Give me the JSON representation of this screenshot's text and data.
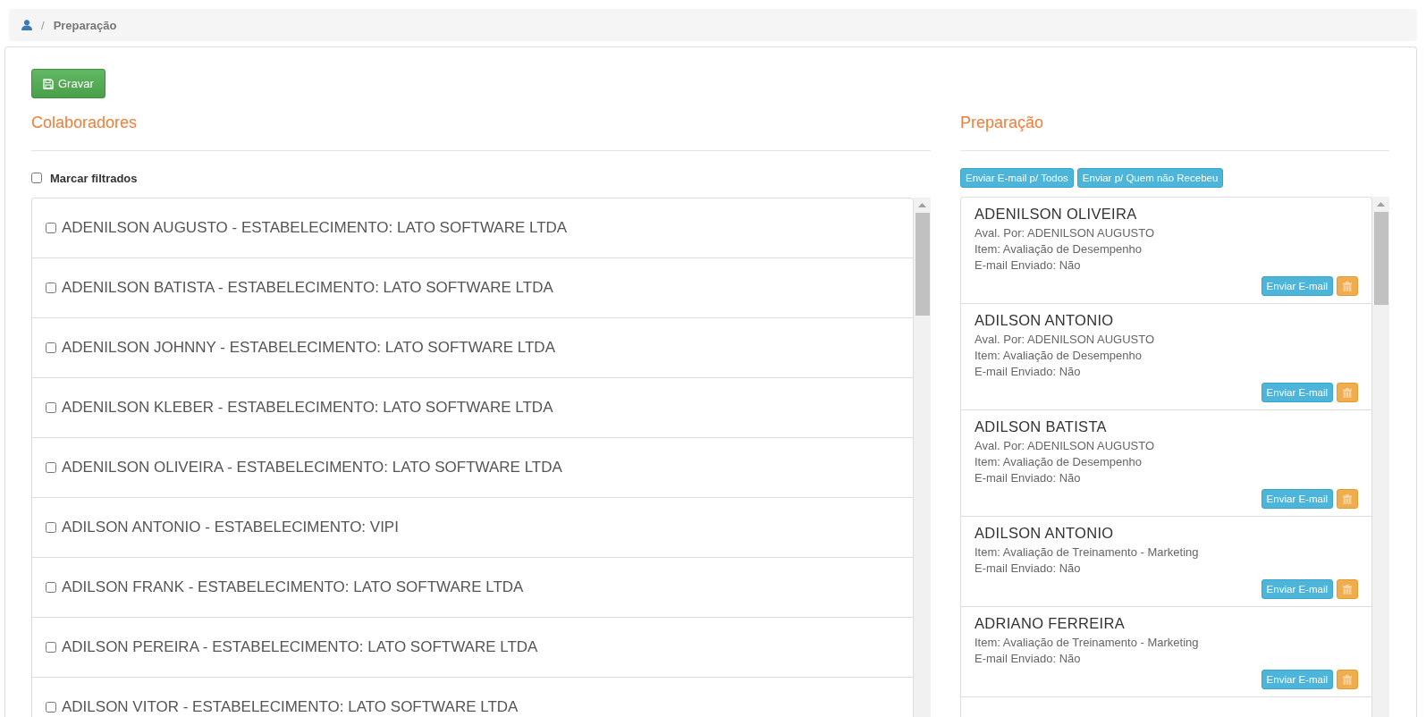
{
  "breadcrumb": {
    "separator": "/",
    "current": "Preparação"
  },
  "save_button": "Gravar",
  "collaborators": {
    "title": "Colaboradores",
    "mark_filtered": {
      "label": "Marcar filtrados",
      "checked": false
    },
    "rows": [
      {
        "label": "ADENILSON AUGUSTO - ESTABELECIMENTO: LATO SOFTWARE LTDA",
        "checked": false
      },
      {
        "label": "ADENILSON BATISTA - ESTABELECIMENTO: LATO SOFTWARE LTDA",
        "checked": false
      },
      {
        "label": "ADENILSON JOHNNY - ESTABELECIMENTO: LATO SOFTWARE LTDA",
        "checked": false
      },
      {
        "label": "ADENILSON KLEBER - ESTABELECIMENTO: LATO SOFTWARE LTDA",
        "checked": false
      },
      {
        "label": "ADENILSON OLIVEIRA - ESTABELECIMENTO: LATO SOFTWARE LTDA",
        "checked": false
      },
      {
        "label": "ADILSON ANTONIO - ESTABELECIMENTO: VIPI",
        "checked": false
      },
      {
        "label": "ADILSON FRANK - ESTABELECIMENTO: LATO SOFTWARE LTDA",
        "checked": false
      },
      {
        "label": "ADILSON PEREIRA - ESTABELECIMENTO: LATO SOFTWARE LTDA",
        "checked": false
      },
      {
        "label": "ADILSON VITOR - ESTABELECIMENTO: LATO SOFTWARE LTDA",
        "checked": false
      }
    ]
  },
  "preparation": {
    "title": "Preparação",
    "actions": [
      "Enviar E-mail p/ Todos",
      "Enviar p/ Quem não Recebeu"
    ],
    "cards": [
      {
        "name": "ADENILSON OLIVEIRA",
        "details": [
          "Aval. Por: ADENILSON AUGUSTO",
          "Item: Avaliação de Desempenho",
          "E-mail Enviado: Não"
        ],
        "send": "Enviar E-mail"
      },
      {
        "name": "ADILSON ANTONIO",
        "details": [
          "Aval. Por: ADENILSON AUGUSTO",
          "Item: Avaliação de Desempenho",
          "E-mail Enviado: Não"
        ],
        "send": "Enviar E-mail"
      },
      {
        "name": "ADILSON BATISTA",
        "details": [
          "Aval. Por: ADENILSON AUGUSTO",
          "Item: Avaliação de Desempenho",
          "E-mail Enviado: Não"
        ],
        "send": "Enviar E-mail"
      },
      {
        "name": "ADILSON ANTONIO",
        "details": [
          "Item: Avaliação de Treinamento - Marketing",
          "E-mail Enviado: Não"
        ],
        "send": "Enviar E-mail"
      },
      {
        "name": "ADRIANO FERREIRA",
        "details": [
          "Item: Avaliação de Treinamento - Marketing",
          "E-mail Enviado: Não"
        ],
        "send": "Enviar E-mail"
      }
    ]
  }
}
